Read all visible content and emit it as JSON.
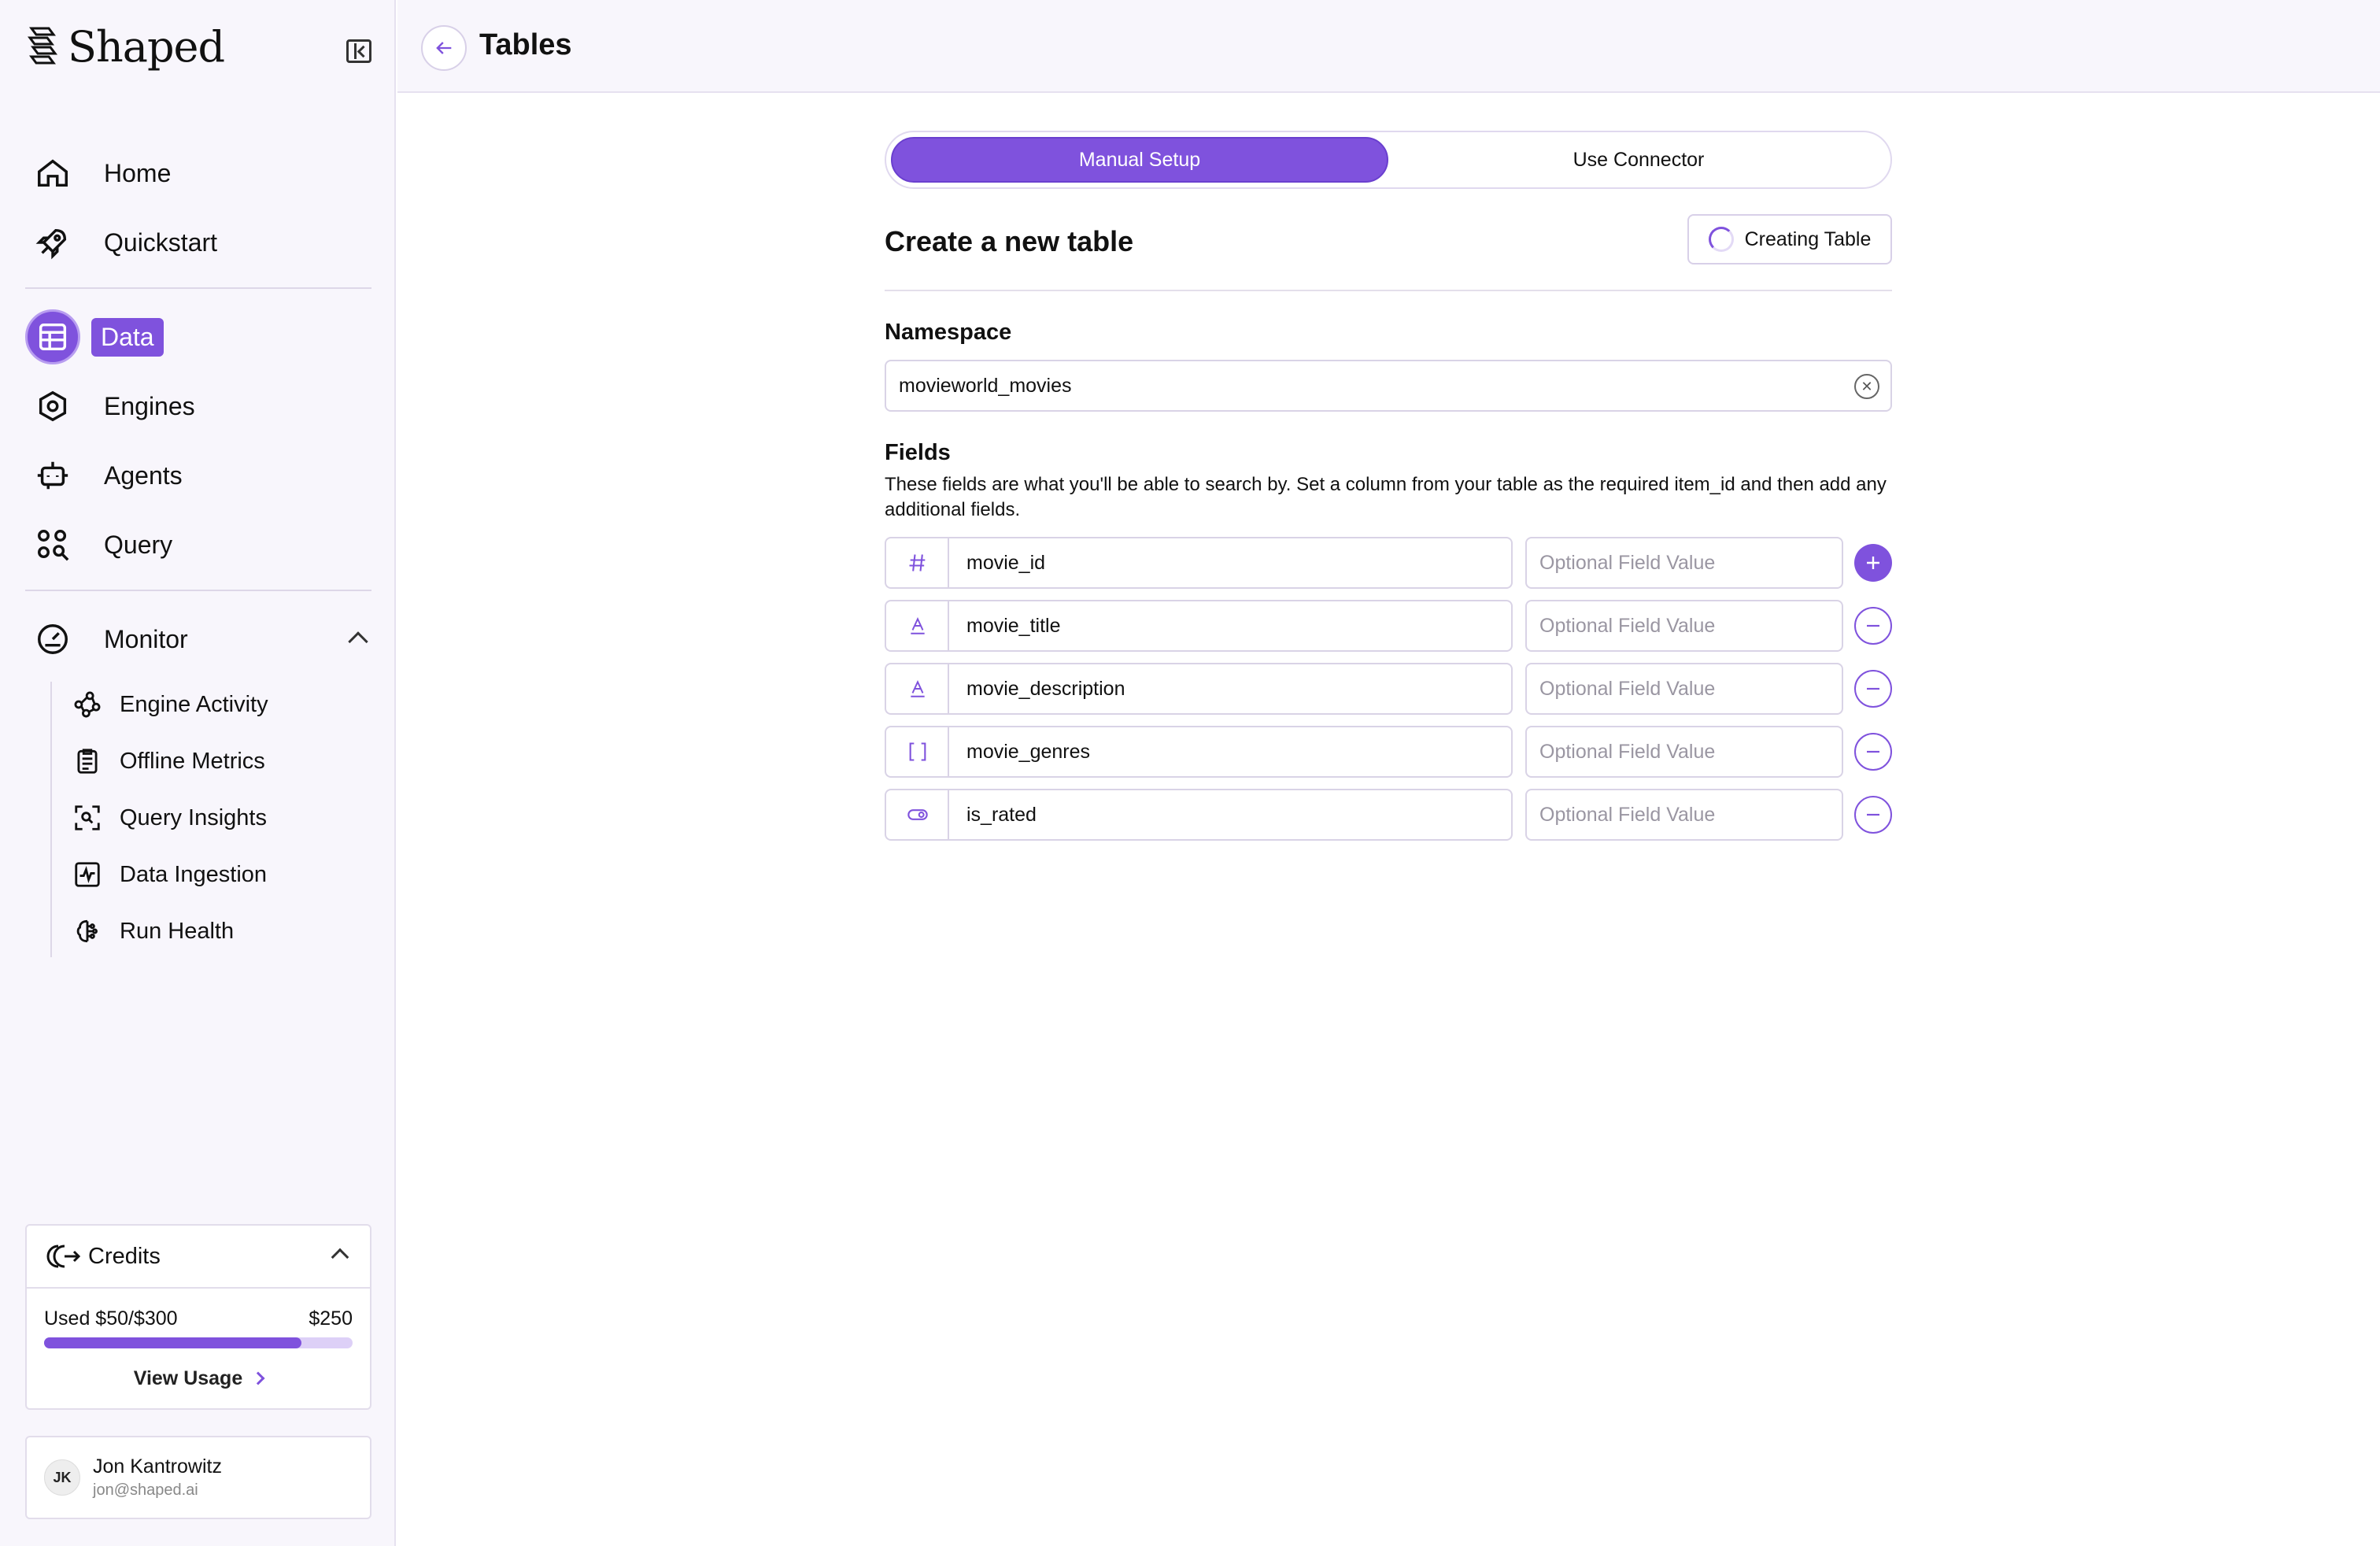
{
  "brand": {
    "name": "Shaped"
  },
  "nav": {
    "home": "Home",
    "quickstart": "Quickstart",
    "data": "Data",
    "engines": "Engines",
    "agents": "Agents",
    "query": "Query",
    "monitor": "Monitor",
    "monitor_items": [
      "Engine Activity",
      "Offline Metrics",
      "Query Insights",
      "Data Ingestion",
      "Run Health"
    ]
  },
  "credits": {
    "title": "Credits",
    "used_label": "Used $50/$300",
    "remaining": "$250",
    "used_fraction": 0.833,
    "view_usage": "View Usage"
  },
  "user": {
    "initials": "JK",
    "name": "Jon Kantrowitz",
    "email": "jon@shaped.ai"
  },
  "header": {
    "title": "Tables"
  },
  "setup": {
    "manual": "Manual Setup",
    "connector": "Use Connector",
    "active": "manual"
  },
  "form": {
    "title": "Create a new table",
    "status_button": "Creating Table",
    "namespace_label": "Namespace",
    "namespace_value": "movieworld_movies",
    "fields_label": "Fields",
    "fields_description": "These fields are what you'll be able to search by. Set a column from your table as the required item_id and then add any additional fields.",
    "value_placeholder": "Optional Field Value",
    "fields": [
      {
        "type_icon": "hash-icon",
        "name": "movie_id",
        "action": "add"
      },
      {
        "type_icon": "text-icon",
        "name": "movie_title",
        "action": "remove"
      },
      {
        "type_icon": "text-icon",
        "name": "movie_description",
        "action": "remove"
      },
      {
        "type_icon": "brackets-icon",
        "name": "movie_genres",
        "action": "remove"
      },
      {
        "type_icon": "toggle-icon",
        "name": "is_rated",
        "action": "remove"
      }
    ]
  },
  "colors": {
    "accent": "#7f52dd",
    "sidebar_bg": "#f8f6fc",
    "border": "#d9d3e6"
  }
}
